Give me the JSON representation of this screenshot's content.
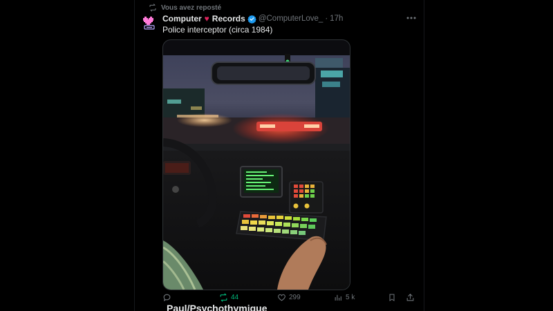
{
  "repost": {
    "label": "Vous avez reposté",
    "icon": "repost-icon"
  },
  "tweet": {
    "author_prefix": "Computer",
    "author_heart": "♥",
    "author_suffix": "Records",
    "handle": "@ComputerLove_",
    "separator": "·",
    "time": "17h",
    "text": "Police interceptor (circa 1984)",
    "media_icon": "photo",
    "actions": {
      "reply_count": "",
      "repost_count": "44",
      "like_count": "299",
      "views_count": "5 k"
    }
  },
  "next_tweet": {
    "author": "Paul/Psychothymique"
  },
  "colors": {
    "background": "#000000",
    "text": "#e7e9ea",
    "muted": "#71767b",
    "verified": "#1d9bf0",
    "repost_active": "#00ba7c",
    "heart": "#e0245e"
  }
}
